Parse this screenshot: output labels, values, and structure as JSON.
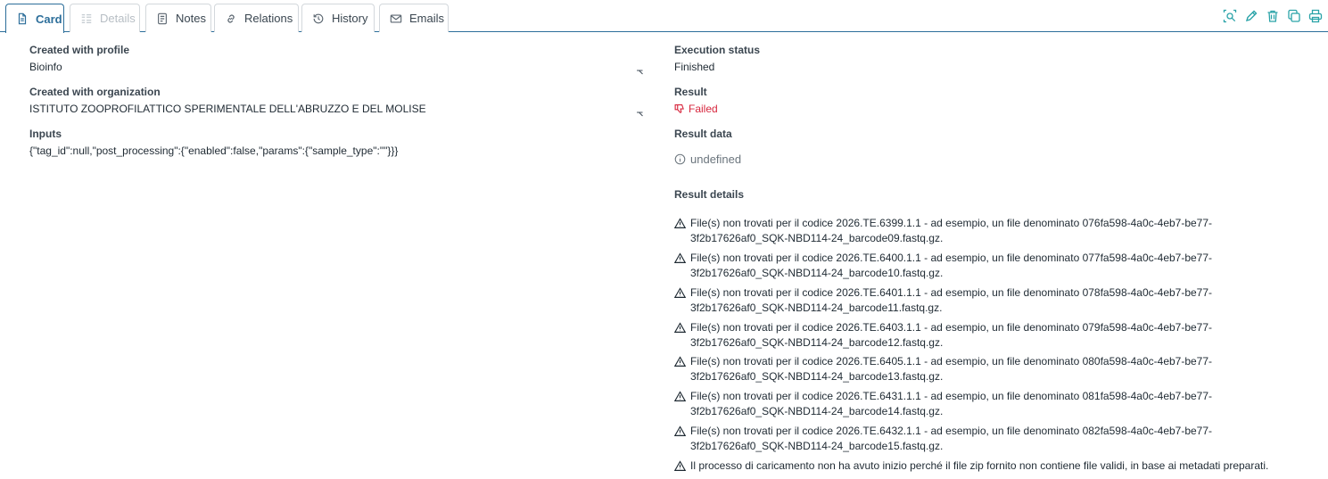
{
  "tabs": [
    {
      "label": "Card",
      "state": "active",
      "icon": "document-icon"
    },
    {
      "label": "Details",
      "state": "disabled",
      "icon": "list-details-icon"
    },
    {
      "label": "Notes",
      "state": "normal",
      "icon": "notes-icon"
    },
    {
      "label": "Relations",
      "state": "normal",
      "icon": "link-icon"
    },
    {
      "label": "History",
      "state": "normal",
      "icon": "history-icon"
    },
    {
      "label": "Emails",
      "state": "normal",
      "icon": "mail-icon"
    }
  ],
  "toolbar": {
    "icons": [
      "search-document-icon",
      "edit-pencil-icon",
      "trash-icon",
      "copy-icon",
      "print-icon"
    ],
    "accent": "#2aa3a8"
  },
  "left": {
    "profile_label": "Created with profile",
    "profile_value": "Bioinfo",
    "org_label": "Created with organization",
    "org_value": "ISTITUTO ZOOPROFILATTICO SPERIMENTALE DELL'ABRUZZO E DEL MOLISE",
    "inputs_label": "Inputs",
    "inputs_value": "{\"tag_id\":null,\"post_processing\":{\"enabled\":false,\"params\":{\"sample_type\":\"\"}}}"
  },
  "right": {
    "status_label": "Execution status",
    "status_value": "Finished",
    "result_label": "Result",
    "result_value": "Failed",
    "result_color": "#d7263d",
    "result_data_label": "Result data",
    "result_data_value": "undefined",
    "details_label": "Result details",
    "details": [
      "File(s) non trovati per il codice 2026.TE.6399.1.1 - ad esempio, un file denominato 076fa598-4a0c-4eb7-be77-3f2b17626af0_SQK-NBD114-24_barcode09.fastq.gz.",
      "File(s) non trovati per il codice 2026.TE.6400.1.1 - ad esempio, un file denominato 077fa598-4a0c-4eb7-be77-3f2b17626af0_SQK-NBD114-24_barcode10.fastq.gz.",
      "File(s) non trovati per il codice 2026.TE.6401.1.1 - ad esempio, un file denominato 078fa598-4a0c-4eb7-be77-3f2b17626af0_SQK-NBD114-24_barcode11.fastq.gz.",
      "File(s) non trovati per il codice 2026.TE.6403.1.1 - ad esempio, un file denominato 079fa598-4a0c-4eb7-be77-3f2b17626af0_SQK-NBD114-24_barcode12.fastq.gz.",
      "File(s) non trovati per il codice 2026.TE.6405.1.1 - ad esempio, un file denominato 080fa598-4a0c-4eb7-be77-3f2b17626af0_SQK-NBD114-24_barcode13.fastq.gz.",
      "File(s) non trovati per il codice 2026.TE.6431.1.1 - ad esempio, un file denominato 081fa598-4a0c-4eb7-be77-3f2b17626af0_SQK-NBD114-24_barcode14.fastq.gz.",
      "File(s) non trovati per il codice 2026.TE.6432.1.1 - ad esempio, un file denominato 082fa598-4a0c-4eb7-be77-3f2b17626af0_SQK-NBD114-24_barcode15.fastq.gz.",
      "Il processo di caricamento non ha avuto inizio perché il file zip fornito non contiene file validi, in base ai metadati preparati."
    ]
  }
}
